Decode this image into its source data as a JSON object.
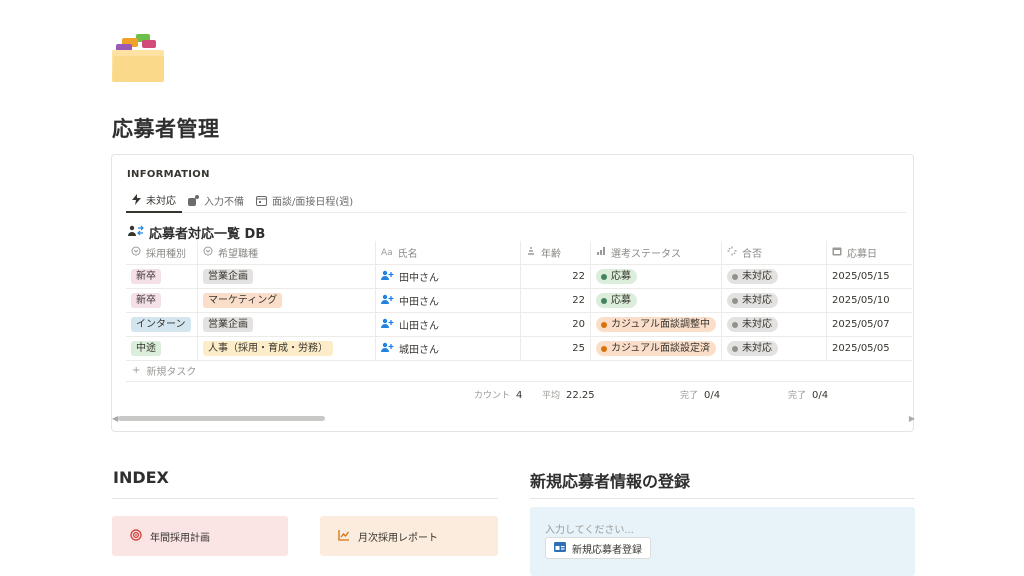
{
  "page": {
    "title": "応募者管理",
    "icon": "folder-icon"
  },
  "info": {
    "label": "INFORMATION",
    "tabs": [
      {
        "label": "未対応",
        "icon": "lightning-icon",
        "active": true
      },
      {
        "label": "入力不備",
        "icon": "alert-icon",
        "active": false
      },
      {
        "label": "面談/面接日程(週)",
        "icon": "calendar-icon",
        "active": false
      }
    ],
    "db_title": "応募者対応一覧 DB",
    "columns": [
      "採用種別",
      "希望職種",
      "氏名",
      "年齢",
      "選考ステータス",
      "合否",
      "応募日"
    ],
    "rows": [
      {
        "type": "新卒",
        "type_color": "pink",
        "job": "営業企画",
        "job_color": "gray",
        "name": "田中さん",
        "age": "22",
        "status": "応募",
        "status_color": "green",
        "result": "未対応",
        "date": "2025/05/15"
      },
      {
        "type": "新卒",
        "type_color": "pink",
        "job": "マーケティング",
        "job_color": "orange",
        "name": "中田さん",
        "age": "22",
        "status": "応募",
        "status_color": "green",
        "result": "未対応",
        "date": "2025/05/10"
      },
      {
        "type": "インターン",
        "type_color": "blue",
        "job": "営業企画",
        "job_color": "gray",
        "name": "山田さん",
        "age": "20",
        "status": "カジュアル面談調整中",
        "status_color": "orange",
        "result": "未対応",
        "date": "2025/05/07"
      },
      {
        "type": "中途",
        "type_color": "green",
        "job": "人事（採用・育成・労務）",
        "job_color": "yellow",
        "name": "城田さん",
        "age": "25",
        "status": "カジュアル面談設定済",
        "status_color": "orange",
        "result": "未対応",
        "date": "2025/05/05"
      }
    ],
    "new_task": "新規タスク",
    "summary": {
      "count_label": "カウント",
      "count_value": "4",
      "avg_label": "平均",
      "avg_value": "22.25",
      "done1_label": "完了",
      "done1_value": "0/4",
      "done2_label": "完了",
      "done2_value": "0/4"
    }
  },
  "index": {
    "title": "INDEX",
    "cards": [
      {
        "label": "年間採用計画",
        "icon": "target-icon",
        "bg": "#fbe4e4"
      },
      {
        "label": "月次採用レポート",
        "icon": "chart-icon",
        "bg": "#fbecdd"
      }
    ]
  },
  "register": {
    "title": "新規応募者情報の登録",
    "placeholder": "入力してください...",
    "button_label": "新規応募者登録",
    "button_icon": "id-card-icon"
  }
}
